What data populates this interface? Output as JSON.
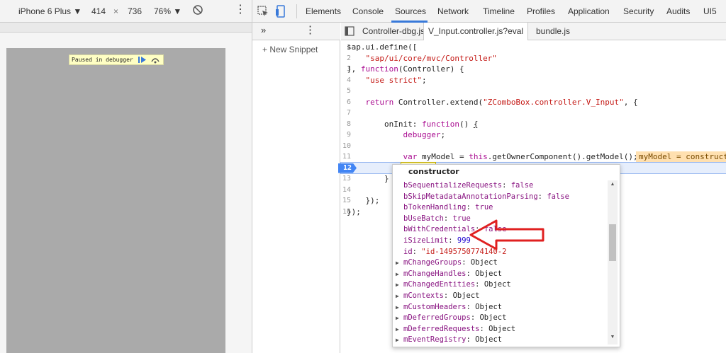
{
  "device_toolbar": {
    "device": "iPhone 6 Plus",
    "width": "414",
    "times": "×",
    "height": "736",
    "zoom": "76%",
    "paused_text": "Paused in debugger"
  },
  "devtools_tabs": [
    "Elements",
    "Console",
    "Sources",
    "Network",
    "Timeline",
    "Profiles",
    "Application",
    "Security",
    "Audits",
    "UI5"
  ],
  "active_tab": "Sources",
  "navigator": {
    "more_label": "»",
    "new_snippet": "+ New Snippet"
  },
  "editor_tabs": [
    "Controller-dbg.js",
    "V_Input.controller.js?eval",
    "bundle.js"
  ],
  "active_editor_tab": "V_Input.controller.js?eval",
  "code": {
    "line_numbers": [
      "1",
      "2",
      "3",
      "4",
      "5",
      "6",
      "7",
      "8",
      "9",
      "10",
      "11",
      "12",
      "13",
      "14",
      "15",
      "16"
    ],
    "current_line": "12",
    "inline_value": "myModel = construct"
  },
  "popover": {
    "title": "constructor",
    "properties": [
      {
        "key": "bSequentializeRequests",
        "value": "false",
        "type": "bool",
        "expandable": false
      },
      {
        "key": "bSkipMetadataAnnotationParsing",
        "value": "false",
        "type": "bool",
        "expandable": false
      },
      {
        "key": "bTokenHandling",
        "value": "true",
        "type": "bool",
        "expandable": false
      },
      {
        "key": "bUseBatch",
        "value": "true",
        "type": "bool",
        "expandable": false
      },
      {
        "key": "bWithCredentials",
        "value": "false",
        "type": "bool",
        "expandable": false
      },
      {
        "key": "iSizeLimit",
        "value": "999",
        "type": "num",
        "expandable": false
      },
      {
        "key": "id",
        "value": "\"id-1495750774140-2",
        "type": "str",
        "expandable": false
      },
      {
        "key": "mChangeGroups",
        "value": "Object",
        "type": "obj",
        "expandable": true
      },
      {
        "key": "mChangeHandles",
        "value": "Object",
        "type": "obj",
        "expandable": true
      },
      {
        "key": "mChangedEntities",
        "value": "Object",
        "type": "obj",
        "expandable": true
      },
      {
        "key": "mContexts",
        "value": "Object",
        "type": "obj",
        "expandable": true
      },
      {
        "key": "mCustomHeaders",
        "value": "Object",
        "type": "obj",
        "expandable": true
      },
      {
        "key": "mDeferredGroups",
        "value": "Object",
        "type": "obj",
        "expandable": true
      },
      {
        "key": "mDeferredRequests",
        "value": "Object",
        "type": "obj",
        "expandable": true
      },
      {
        "key": "mEventRegistry",
        "value": "Object",
        "type": "obj",
        "expandable": true
      }
    ]
  },
  "colors": {
    "accent": "#3879d9",
    "breakpoint": "#4285f4",
    "arrow": "#e02020"
  }
}
